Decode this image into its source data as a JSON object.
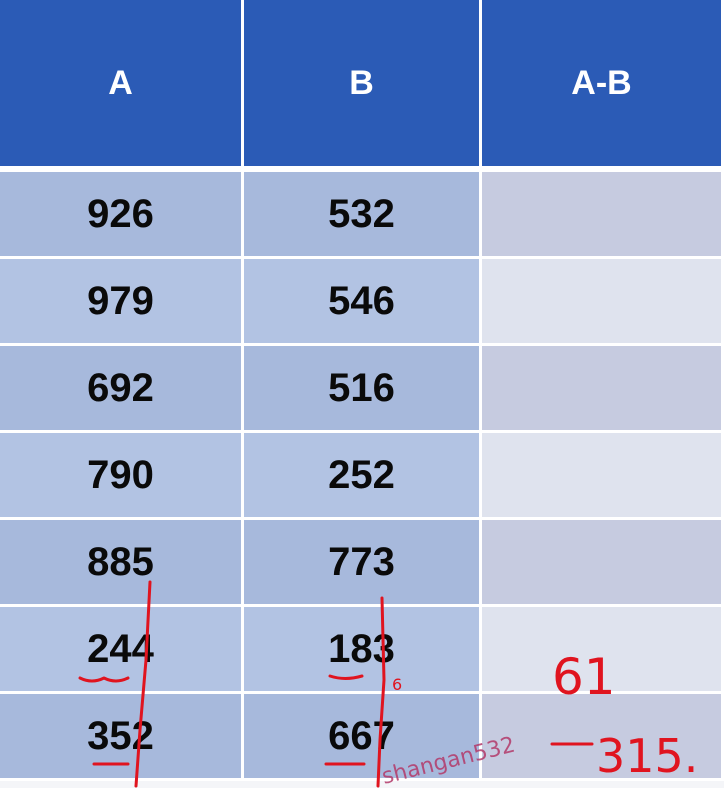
{
  "table": {
    "headers": [
      "A",
      "B",
      "A-B"
    ],
    "rows": [
      {
        "a": "926",
        "b": "532",
        "diff": ""
      },
      {
        "a": "979",
        "b": "546",
        "diff": ""
      },
      {
        "a": "692",
        "b": "516",
        "diff": ""
      },
      {
        "a": "790",
        "b": "252",
        "diff": ""
      },
      {
        "a": "885",
        "b": "773",
        "diff": ""
      },
      {
        "a": "244",
        "b": "183",
        "diff": ""
      },
      {
        "a": "352",
        "b": "667",
        "diff": ""
      }
    ]
  },
  "annotations": {
    "answer_row6": "61",
    "answer_row7": "315.",
    "small_note": "6"
  },
  "watermark": "shangan532",
  "colors": {
    "header_bg": "#2b5bb6",
    "ab_cells": "#a7b9dc",
    "result_cells_dark": "#c6cbe0",
    "result_cells_light": "#dfe3ee",
    "handwriting": "#e0141f"
  }
}
